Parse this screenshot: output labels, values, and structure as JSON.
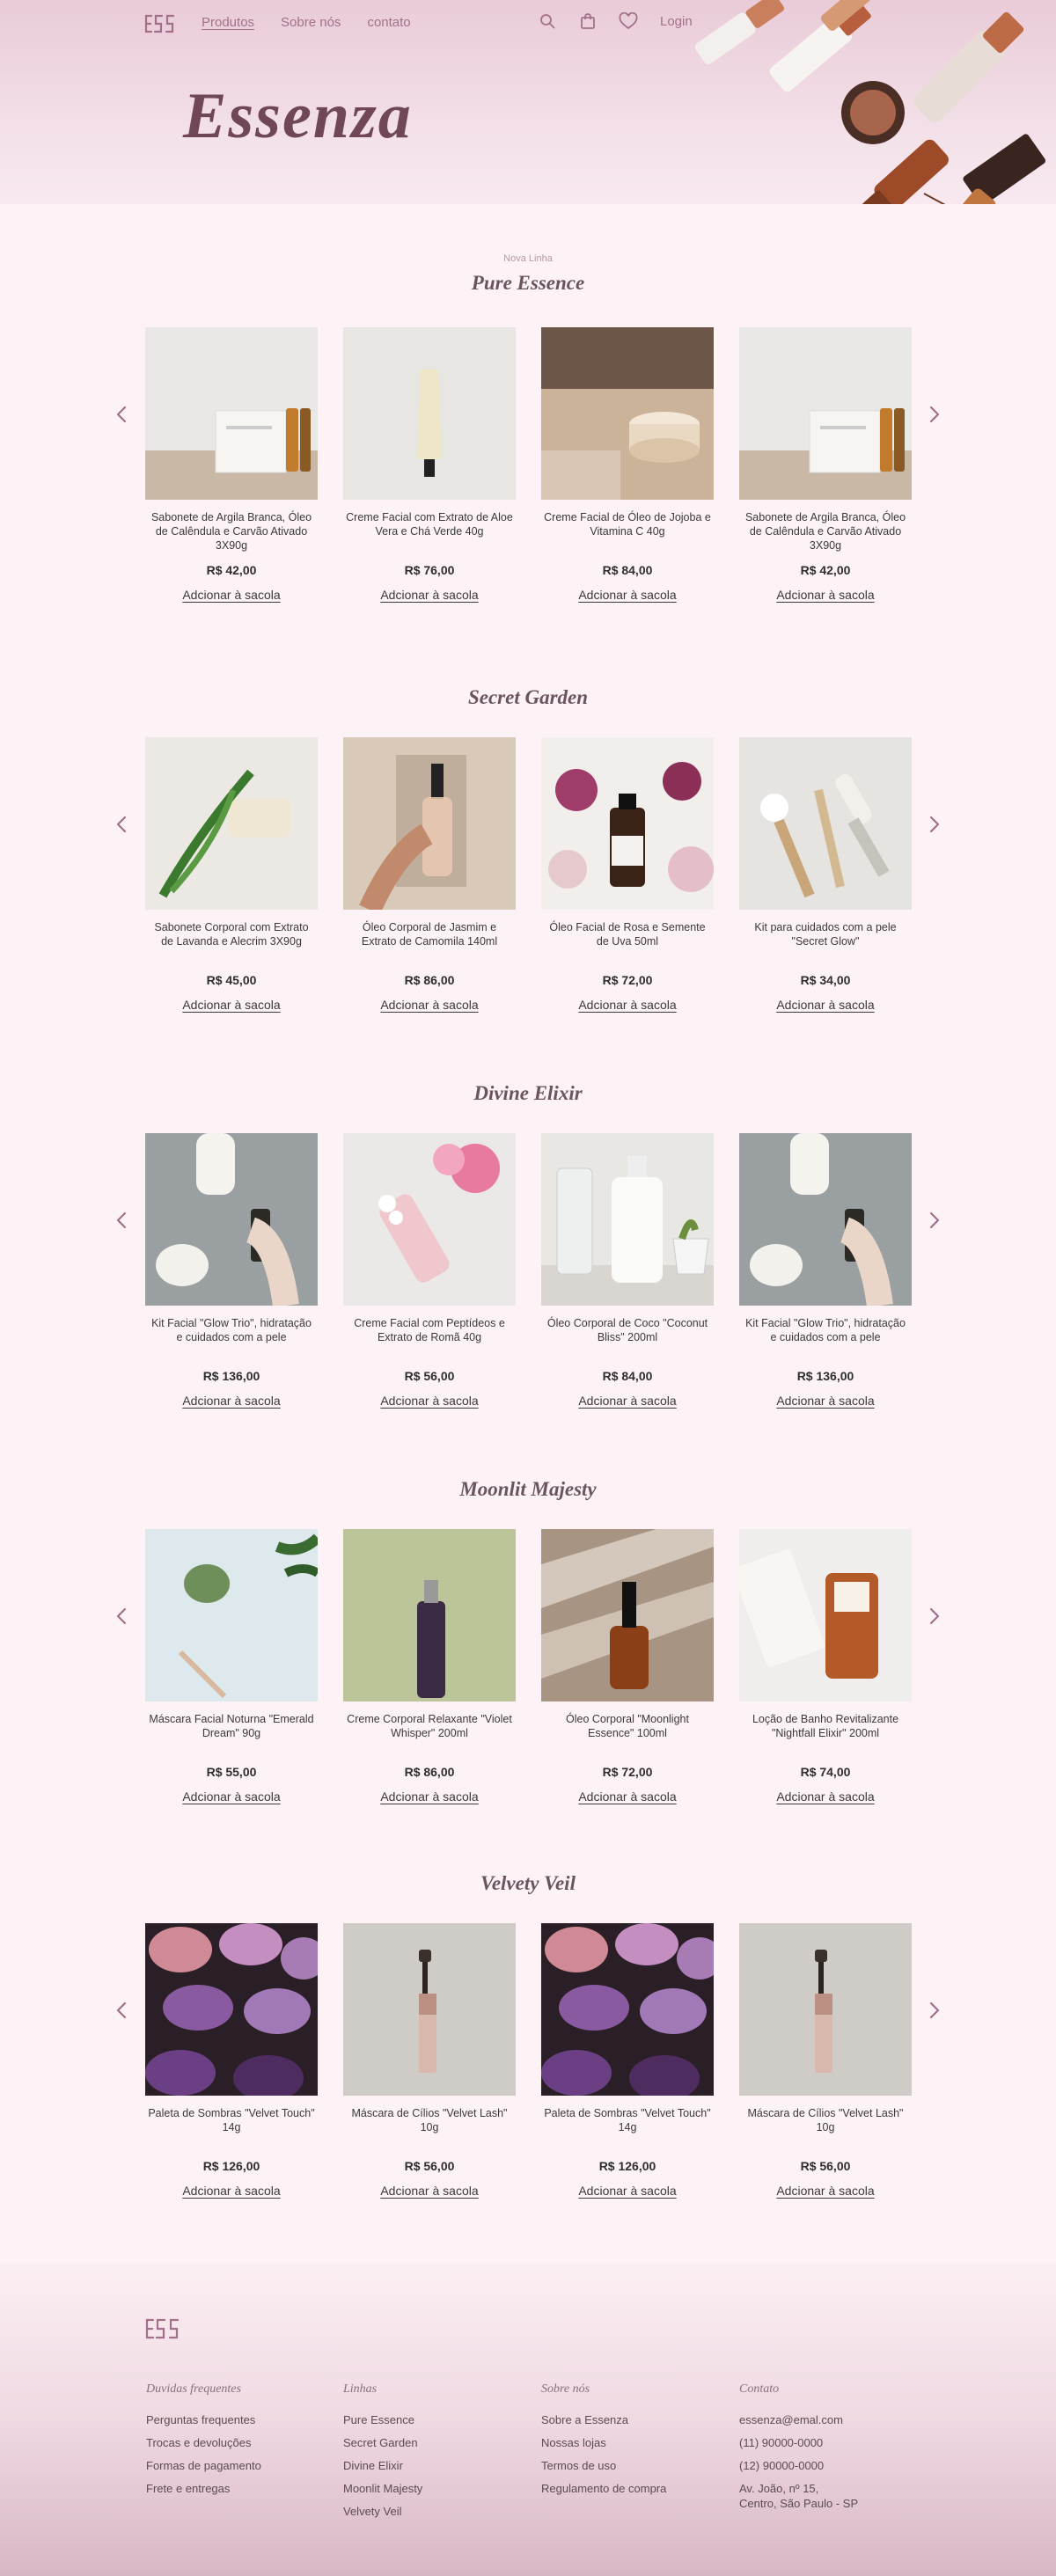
{
  "nav": {
    "links": [
      "Produtos",
      "Sobre nós",
      "contato"
    ],
    "login": "Login"
  },
  "hero": {
    "brand": "Essenza"
  },
  "sections": [
    {
      "subtitle": "Nova Linha",
      "title": "Pure Essence",
      "products": [
        {
          "name": "Sabonete de Argila Branca, Óleo de Calêndula e Carvão Ativado 3X90g",
          "price": "R$ 42,00",
          "cta": "Adcionar à sacola"
        },
        {
          "name": "Creme Facial com Extrato de Aloe Vera e Chá Verde 40g",
          "price": "R$ 76,00",
          "cta": "Adcionar à sacola"
        },
        {
          "name": "Creme Facial de Óleo de Jojoba e Vitamina C 40g",
          "price": "R$ 84,00",
          "cta": "Adcionar à sacola"
        },
        {
          "name": "Sabonete de Argila Branca, Óleo de Calêndula e Carvão Ativado 3X90g",
          "price": "R$ 42,00",
          "cta": "Adcionar à sacola"
        }
      ]
    },
    {
      "subtitle": "",
      "title": "Secret Garden",
      "products": [
        {
          "name": "Sabonete Corporal com Extrato de Lavanda e Alecrim 3X90g",
          "price": "R$ 45,00",
          "cta": "Adcionar à sacola"
        },
        {
          "name": "Óleo Corporal de Jasmim e Extrato de Camomila 140ml",
          "price": "R$ 86,00",
          "cta": "Adcionar à sacola"
        },
        {
          "name": "Óleo Facial de Rosa e Semente de Uva 50ml",
          "price": "R$ 72,00",
          "cta": "Adcionar à sacola"
        },
        {
          "name": "Kit para cuidados com a pele \"Secret Glow\"",
          "price": "R$ 34,00",
          "cta": "Adcionar à sacola"
        }
      ]
    },
    {
      "subtitle": "",
      "title": "Divine Elixir",
      "products": [
        {
          "name": "Kit Facial \"Glow Trio\", hidratação e cuidados com a pele",
          "price": "R$ 136,00",
          "cta": "Adcionar à sacola"
        },
        {
          "name": "Creme Facial com Peptídeos e Extrato de Romã 40g",
          "price": "R$ 56,00",
          "cta": "Adcionar à sacola"
        },
        {
          "name": "Óleo Corporal de Coco \"Coconut Bliss\" 200ml",
          "price": "R$ 84,00",
          "cta": "Adcionar à sacola"
        },
        {
          "name": "Kit Facial \"Glow Trio\", hidratação e cuidados com a pele",
          "price": "R$ 136,00",
          "cta": "Adcionar à sacola"
        }
      ]
    },
    {
      "subtitle": "",
      "title": "Moonlit Majesty",
      "products": [
        {
          "name": "Máscara Facial Noturna \"Emerald Dream\" 90g",
          "price": "R$ 55,00",
          "cta": "Adcionar à sacola"
        },
        {
          "name": "Creme Corporal Relaxante \"Violet Whisper\" 200ml",
          "price": "R$ 86,00",
          "cta": "Adcionar à sacola"
        },
        {
          "name": "Óleo Corporal \"Moonlight Essence\" 100ml",
          "price": "R$ 72,00",
          "cta": "Adcionar à sacola"
        },
        {
          "name": "Loção de Banho Revitalizante \"Nightfall Elixir\" 200ml",
          "price": "R$ 74,00",
          "cta": "Adcionar à sacola"
        }
      ]
    },
    {
      "subtitle": "",
      "title": "Velvety Veil",
      "products": [
        {
          "name": "Paleta de Sombras \"Velvet Touch\" 14g",
          "price": "R$ 126,00",
          "cta": "Adcionar à sacola"
        },
        {
          "name": "Máscara de Cílios \"Velvet Lash\" 10g",
          "price": "R$ 56,00",
          "cta": "Adcionar à sacola"
        },
        {
          "name": "Paleta de Sombras \"Velvet Touch\" 14g",
          "price": "R$ 126,00",
          "cta": "Adcionar à sacola"
        },
        {
          "name": "Máscara de Cílios \"Velvet Lash\" 10g",
          "price": "R$ 56,00",
          "cta": "Adcionar à sacola"
        }
      ]
    }
  ],
  "footer": {
    "columns": [
      {
        "title": "Duvidas frequentes",
        "links": [
          "Perguntas frequentes",
          "Trocas e devoluções",
          "Formas de pagamento",
          "Frete e entregas"
        ]
      },
      {
        "title": "Linhas",
        "links": [
          "Pure Essence",
          "Secret Garden",
          "Divine Elixir",
          "Moonlit  Majesty",
          "Velvety Veil"
        ]
      },
      {
        "title": "Sobre nós",
        "links": [
          "Sobre a Essenza",
          "Nossas lojas",
          "Termos de uso",
          "Regulamento de compra"
        ]
      },
      {
        "title": "Contato",
        "links": [
          "essenza@emal.com",
          "(11) 90000-0000",
          "(12) 90000-0000"
        ],
        "address": [
          "Av. João, nº 15,",
          "Centro, São Paulo - SP"
        ]
      }
    ]
  },
  "colors": {
    "accent": "#a2708a",
    "brand": "#6f4759",
    "background": "#fdf2f5"
  },
  "icons": [
    "search-icon",
    "bag-icon",
    "heart-icon",
    "chevron-left-icon",
    "chevron-right-icon"
  ]
}
